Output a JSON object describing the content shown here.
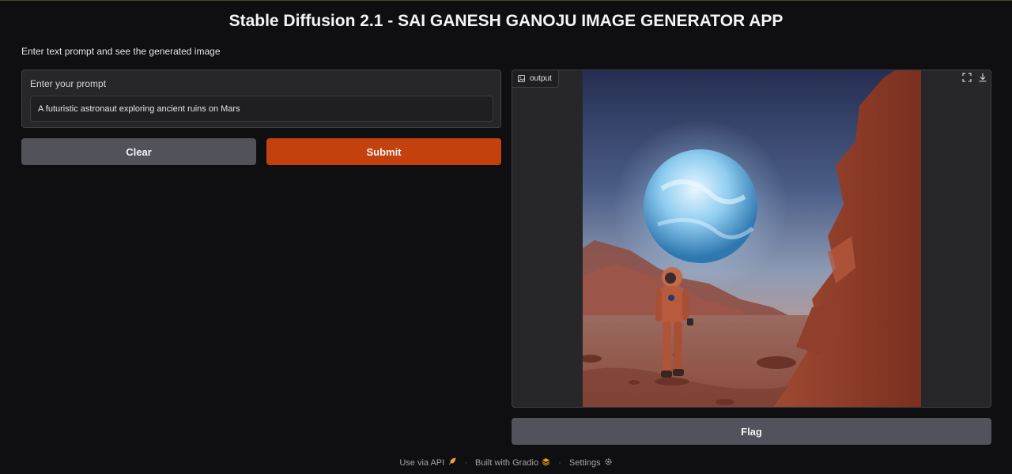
{
  "app": {
    "title": "Stable Diffusion 2.1 - SAI GANESH GANOJU IMAGE GENERATOR APP",
    "description": "Enter text prompt and see the generated image"
  },
  "input": {
    "label": "Enter your prompt",
    "value": "A futuristic astronaut exploring ancient ruins on Mars"
  },
  "buttons": {
    "clear": "Clear",
    "submit": "Submit",
    "flag": "Flag"
  },
  "output": {
    "label": "output",
    "icons": [
      "image-icon",
      "fullscreen-icon",
      "download-icon"
    ]
  },
  "footer": {
    "api": "Use via API",
    "built": "Built with Gradio",
    "settings": "Settings",
    "separator": "·"
  },
  "colors": {
    "background": "#0f0f11",
    "panel": "#27272a",
    "accent": "#c2410c",
    "secondary_button": "#52525b"
  }
}
